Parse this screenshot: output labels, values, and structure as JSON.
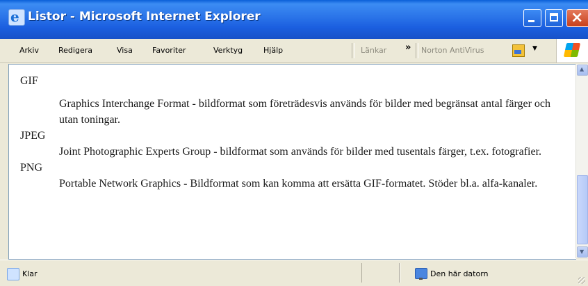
{
  "window": {
    "title": "Listor - Microsoft Internet Explorer",
    "icon": "ie-icon",
    "controls": {
      "minimize": "minimize-icon",
      "maximize": "maximize-icon",
      "close": "close-icon"
    }
  },
  "menubar": {
    "items": [
      "Arkiv",
      "Redigera",
      "Visa",
      "Favoriter",
      "Verktyg",
      "Hjälp"
    ],
    "links_label": "Länkar",
    "chevron": "»",
    "norton_label": "Norton AntiVirus",
    "dropdown": "▼"
  },
  "content": {
    "terms": [
      {
        "term": "GIF",
        "definition": "Graphics Interchange Format - bildformat som företrädesvis används för bilder med begränsat antal färger och utan toningar."
      },
      {
        "term": "JPEG",
        "definition": "Joint Photographic Experts Group - bildformat som används för bilder med tusentals färger, t.ex. fotografier."
      },
      {
        "term": "PNG",
        "definition": "Portable Network Graphics - Bildformat som kan komma att ersätta GIF-formatet. Stöder bl.a. alfa-kanaler."
      }
    ]
  },
  "statusbar": {
    "status": "Klar",
    "zone": "Den här datorn"
  },
  "colors": {
    "titlebar": "#2a73e8",
    "chrome": "#ece9d8",
    "close_button": "#c8401c"
  }
}
